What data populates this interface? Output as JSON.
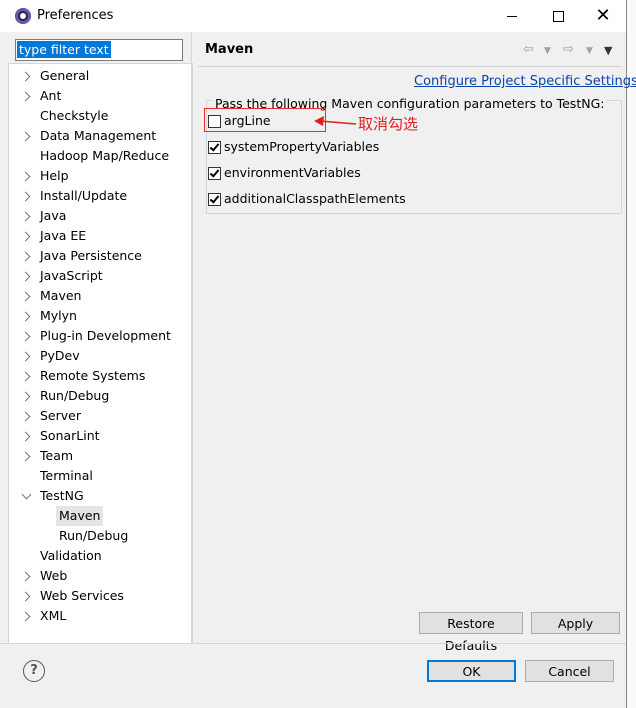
{
  "window": {
    "title": "Preferences",
    "min_icon": "minimize-icon",
    "max_icon": "maximize-icon",
    "close_icon": "close-icon"
  },
  "filter": {
    "value": "type filter text"
  },
  "tree": {
    "items": [
      {
        "label": "General",
        "expand": "right"
      },
      {
        "label": "Ant",
        "expand": "right"
      },
      {
        "label": "Checkstyle",
        "expand": "none"
      },
      {
        "label": "Data Management",
        "expand": "right"
      },
      {
        "label": "Hadoop Map/Reduce",
        "expand": "none"
      },
      {
        "label": "Help",
        "expand": "right"
      },
      {
        "label": "Install/Update",
        "expand": "right"
      },
      {
        "label": "Java",
        "expand": "right"
      },
      {
        "label": "Java EE",
        "expand": "right"
      },
      {
        "label": "Java Persistence",
        "expand": "right"
      },
      {
        "label": "JavaScript",
        "expand": "right"
      },
      {
        "label": "Maven",
        "expand": "right"
      },
      {
        "label": "Mylyn",
        "expand": "right"
      },
      {
        "label": "Plug-in Development",
        "expand": "right"
      },
      {
        "label": "PyDev",
        "expand": "right"
      },
      {
        "label": "Remote Systems",
        "expand": "right"
      },
      {
        "label": "Run/Debug",
        "expand": "right"
      },
      {
        "label": "Server",
        "expand": "right"
      },
      {
        "label": "SonarLint",
        "expand": "right"
      },
      {
        "label": "Team",
        "expand": "right"
      },
      {
        "label": "Terminal",
        "expand": "none"
      },
      {
        "label": "TestNG",
        "expand": "down"
      },
      {
        "label": "Maven",
        "expand": "child",
        "selected": true
      },
      {
        "label": "Run/Debug",
        "expand": "child"
      },
      {
        "label": "Validation",
        "expand": "none"
      },
      {
        "label": "Web",
        "expand": "right"
      },
      {
        "label": "Web Services",
        "expand": "right"
      },
      {
        "label": "XML",
        "expand": "right"
      }
    ]
  },
  "page": {
    "title": "Maven",
    "back_icon": "back-arrow-icon",
    "forward_icon": "forward-arrow-icon",
    "menu_icon": "view-menu-icon",
    "configure_link": "Configure Project Specific Settings...",
    "group_label": "Pass the following Maven configuration parameters to TestNG:",
    "options": [
      {
        "label": "argLine",
        "checked": false
      },
      {
        "label": "systemPropertyVariables",
        "checked": true
      },
      {
        "label": "environmentVariables",
        "checked": true
      },
      {
        "label": "additionalClasspathElements",
        "checked": true
      }
    ],
    "annotation": "取消勾选",
    "annotation_color": "#e02020"
  },
  "buttons": {
    "restore": "Restore Defaults",
    "apply": "Apply",
    "ok": "OK",
    "cancel": "Cancel"
  },
  "help_icon": "help-icon"
}
